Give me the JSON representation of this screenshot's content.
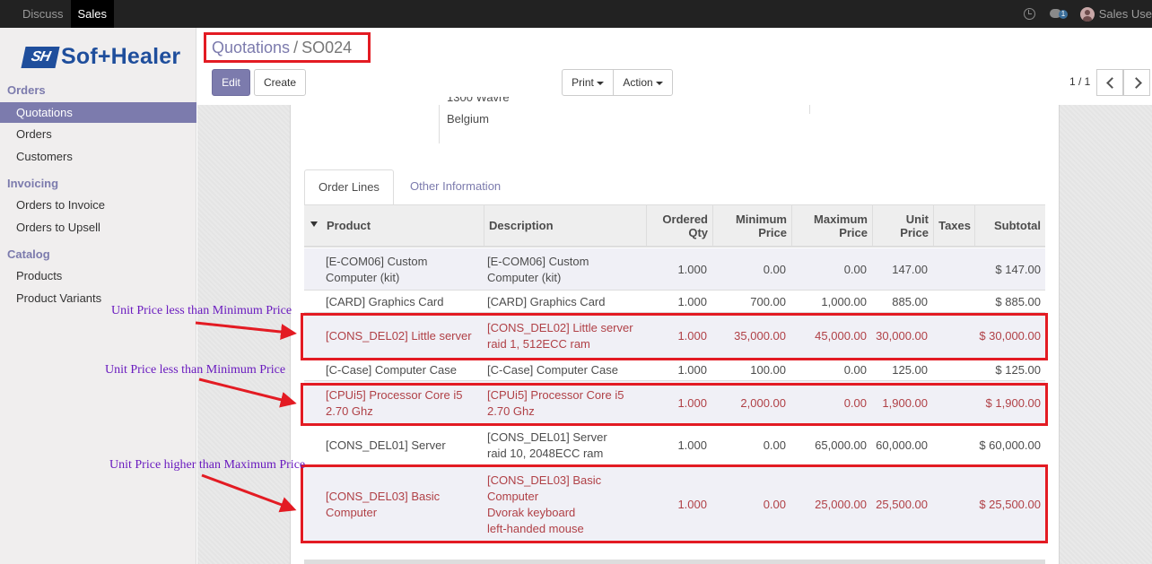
{
  "topbar": {
    "menu": [
      "Discuss",
      "Sales"
    ],
    "active": "Sales",
    "chat_count": "1",
    "user": "Sales Use"
  },
  "sidebar": {
    "logo_mark": "SH",
    "logo_text": "Sof+Healer",
    "sections": [
      {
        "title": "Orders",
        "items": [
          "Quotations",
          "Orders",
          "Customers"
        ]
      },
      {
        "title": "Invoicing",
        "items": [
          "Orders to Invoice",
          "Orders to Upsell"
        ]
      },
      {
        "title": "Catalog",
        "items": [
          "Products",
          "Product Variants"
        ]
      }
    ],
    "active_item": "Quotations"
  },
  "breadcrumb": {
    "parent": "Quotations",
    "sep": "/",
    "current": "SO024"
  },
  "buttons": {
    "edit": "Edit",
    "create": "Create",
    "print": "Print",
    "action": "Action"
  },
  "pager": "1 / 1",
  "address": {
    "line1": "1300 Wavre",
    "line2": "Belgium"
  },
  "tabs": [
    "Order Lines",
    "Other Information"
  ],
  "table": {
    "headers": {
      "product": "Product",
      "description": "Description",
      "qty": [
        "Ordered",
        "Qty"
      ],
      "min": [
        "Minimum",
        "Price"
      ],
      "max": [
        "Maximum",
        "Price"
      ],
      "unit": [
        "Unit",
        "Price"
      ],
      "taxes": "Taxes",
      "subtotal": "Subtotal"
    },
    "rows": [
      {
        "product": [
          "[E-COM06] Custom",
          "Computer (kit)"
        ],
        "description": [
          "[E-COM06] Custom",
          "Computer (kit)"
        ],
        "qty": "1.000",
        "min": "0.00",
        "max": "0.00",
        "unit": "147.00",
        "taxes": "",
        "subtotal": "$ 147.00"
      },
      {
        "product": [
          "[CARD] Graphics Card"
        ],
        "description": [
          "[CARD] Graphics Card"
        ],
        "qty": "1.000",
        "min": "700.00",
        "max": "1,000.00",
        "unit": "885.00",
        "taxes": "",
        "subtotal": "$ 885.00"
      },
      {
        "product": [
          "[CONS_DEL02] Little server"
        ],
        "description": [
          "[CONS_DEL02] Little server",
          "raid 1, 512ECC ram"
        ],
        "qty": "1.000",
        "min": "35,000.00",
        "max": "45,000.00",
        "unit": "30,000.00",
        "taxes": "",
        "subtotal": "$ 30,000.00"
      },
      {
        "product": [
          "[C-Case] Computer Case"
        ],
        "description": [
          "[C-Case] Computer Case"
        ],
        "qty": "1.000",
        "min": "100.00",
        "max": "0.00",
        "unit": "125.00",
        "taxes": "",
        "subtotal": "$ 125.00"
      },
      {
        "product": [
          "[CPUi5] Processor Core i5",
          "2.70 Ghz"
        ],
        "description": [
          "[CPUi5] Processor Core i5",
          "2.70 Ghz"
        ],
        "qty": "1.000",
        "min": "2,000.00",
        "max": "0.00",
        "unit": "1,900.00",
        "taxes": "",
        "subtotal": "$ 1,900.00"
      },
      {
        "product": [
          "[CONS_DEL01] Server"
        ],
        "description": [
          "[CONS_DEL01] Server",
          "raid 10, 2048ECC ram"
        ],
        "qty": "1.000",
        "min": "0.00",
        "max": "65,000.00",
        "unit": "60,000.00",
        "taxes": "",
        "subtotal": "$ 60,000.00"
      },
      {
        "product": [
          "[CONS_DEL03] Basic",
          "Computer"
        ],
        "description": [
          "[CONS_DEL03] Basic",
          "Computer",
          "Dvorak keyboard",
          "left-handed mouse"
        ],
        "qty": "1.000",
        "min": "0.00",
        "max": "25,000.00",
        "unit": "25,500.00",
        "taxes": "",
        "subtotal": "$ 25,500.00"
      }
    ]
  },
  "annotations": [
    "Unit Price less than Minimum Price",
    "Unit Price less than Minimum Price",
    "Unit Price higher than Maximum Price"
  ],
  "colors": {
    "accent": "#7c7bad",
    "highlight": "#e31b23",
    "warning_text": "#b04046",
    "annotation": "#6a1bbf"
  }
}
